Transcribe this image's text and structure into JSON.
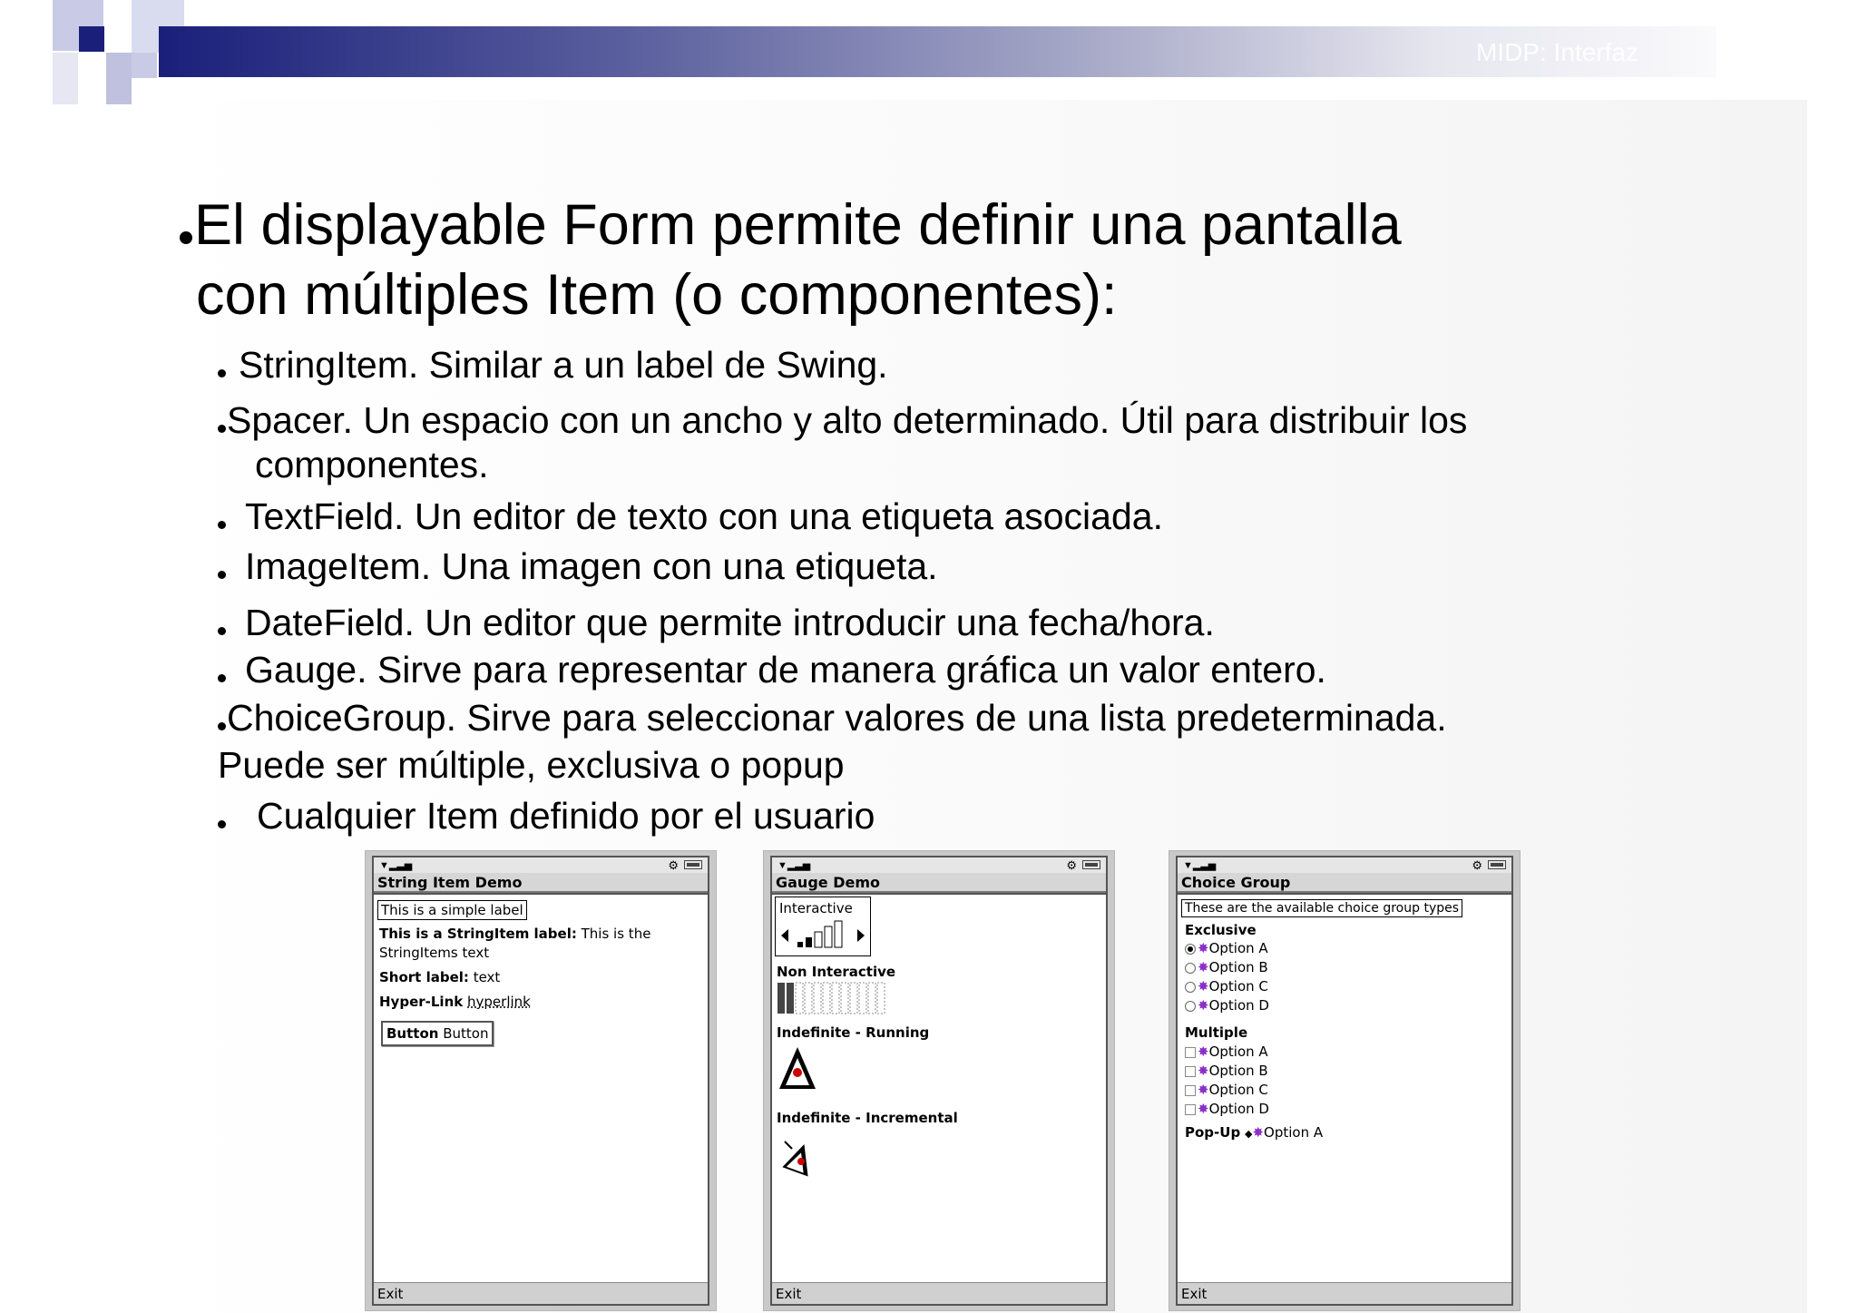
{
  "header": {
    "text": "MIDP: Interfaz"
  },
  "main_bullet": {
    "line1": "El displayable Form permite definir una pantalla",
    "line2": "con múltiples Item (o componentes):"
  },
  "items": [
    {
      "text": "StringItem. Similar a un label de Swing."
    },
    {
      "line1": "Spacer. Un espacio con un ancho y alto determinado. Útil para distribuir los",
      "line2": "componentes."
    },
    {
      "text": "TextField. Un editor de texto con una etiqueta asociada."
    },
    {
      "text": "ImageItem. Una imagen con una etiqueta."
    },
    {
      "text": "DateField. Un editor que permite introducir una fecha/hora."
    },
    {
      "text": "Gauge. Sirve para representar de manera gráfica un valor entero."
    },
    {
      "line1": "ChoiceGroup. Sirve para seleccionar valores de una lista predeterminada.",
      "line2": "Puede ser múltiple, exclusiva o popup"
    },
    {
      "text": "Cualquier Item definido por el usuario"
    }
  ],
  "screens": {
    "string_item": {
      "title": "String Item Demo",
      "simple_label": "This is a simple label",
      "stringitem_label": "This is a StringItem label:",
      "stringitem_text1": "This is the",
      "stringitem_text2": "StringItems text",
      "short_label": "Short label:",
      "short_text": "text",
      "hyper_label": "Hyper-Link",
      "hyper_text": "hyperlink",
      "button_label": "Button",
      "button_text": "Button",
      "softkey": "Exit"
    },
    "gauge": {
      "title": "Gauge Demo",
      "interactive": "Interactive",
      "non_interactive": "Non Interactive",
      "indefinite_running": "Indefinite - Running",
      "indefinite_incremental": "Indefinite - Incremental",
      "softkey": "Exit"
    },
    "choice_group": {
      "title": "Choice Group",
      "intro": "These are the available choice group types",
      "exclusive_label": "Exclusive",
      "exclusive_options": [
        "Option A",
        "Option B",
        "Option C",
        "Option D"
      ],
      "multiple_label": "Multiple",
      "multiple_options": [
        "Option A",
        "Option B",
        "Option C",
        "Option D"
      ],
      "popup_label": "Pop-Up",
      "popup_value": "Option A",
      "softkey": "Exit"
    }
  }
}
